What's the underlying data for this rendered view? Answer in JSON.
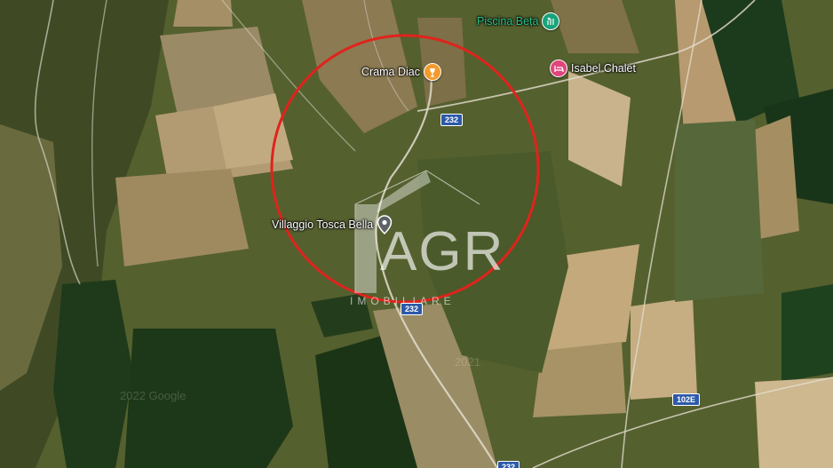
{
  "map": {
    "pois": [
      {
        "name": "Piscina Beța",
        "type": "pool",
        "icon": "pool-icon",
        "color": "#18a37a"
      },
      {
        "name": "Crama Diac",
        "type": "winery",
        "icon": "wine-glass-icon",
        "color": "#f29b2d"
      },
      {
        "name": "Isabel Chalet",
        "type": "lodging",
        "icon": "bed-icon",
        "color": "#e0457b"
      },
      {
        "name": "Villaggio Tosca Bella",
        "type": "place",
        "icon": "location-pin-icon",
        "color": "#5f6368"
      }
    ],
    "roads": [
      {
        "ref": "232"
      },
      {
        "ref": "232"
      },
      {
        "ref": "102E"
      },
      {
        "ref": "232"
      }
    ],
    "highlight_circle_color": "#e0231c",
    "watermark": {
      "brand": "AGR",
      "subtitle": "IMOBILIARE"
    },
    "copyright_fragments": [
      "2022 Google",
      "2021"
    ]
  }
}
